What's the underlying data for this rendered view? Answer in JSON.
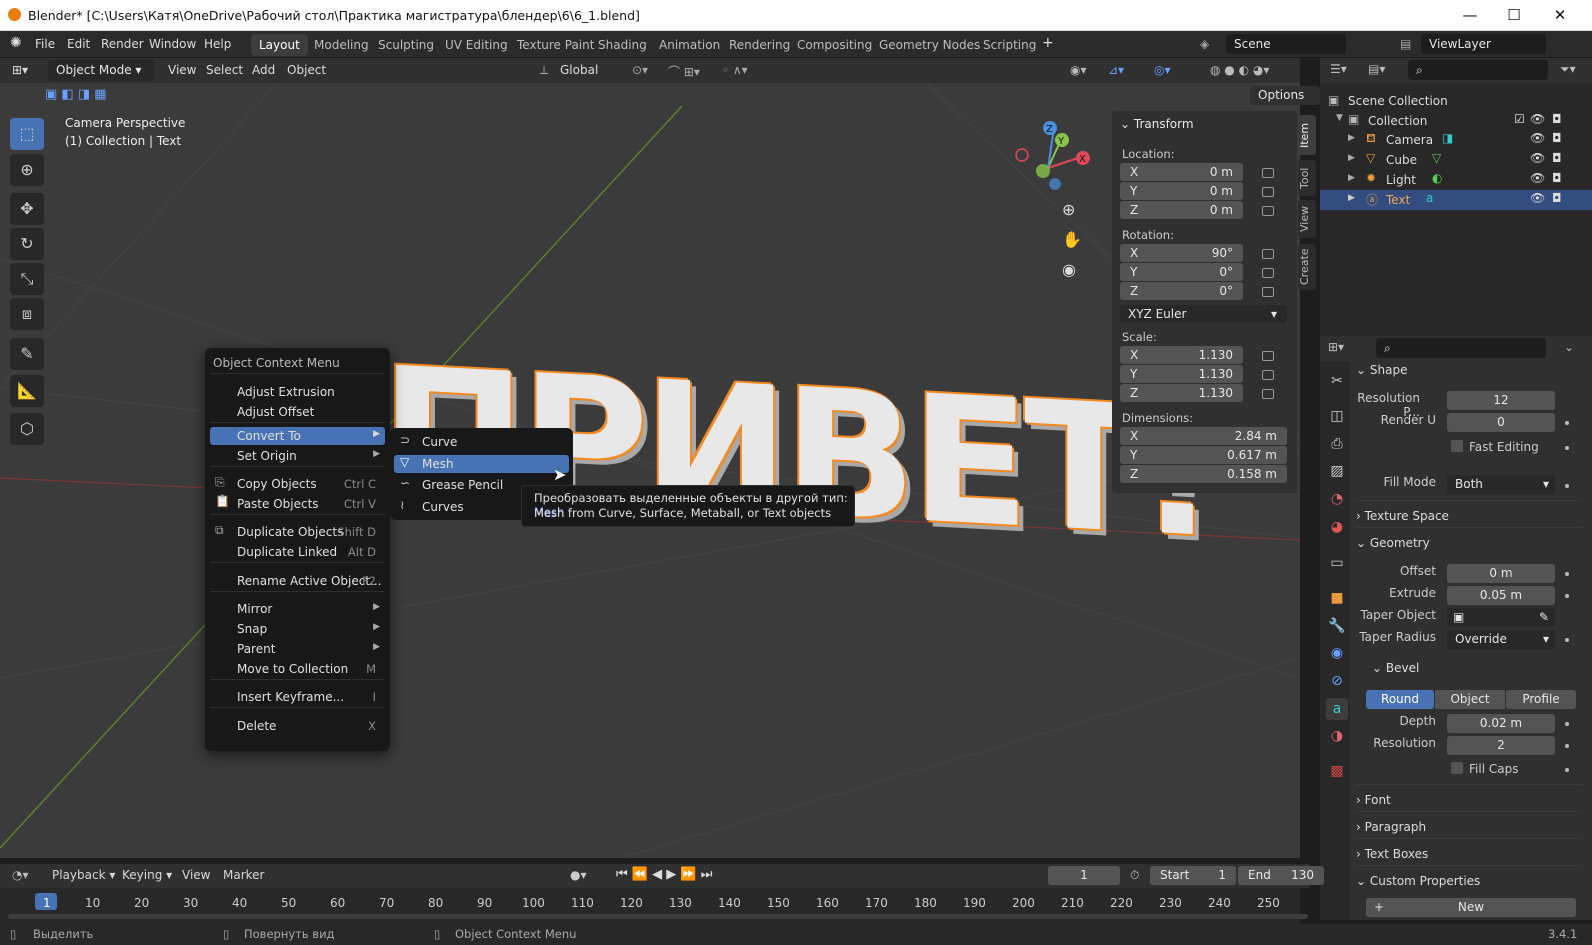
{
  "window": {
    "title": "Blender* [C:\\Users\\Катя\\OneDrive\\Рабочий стол\\Практика магистратура\\блендер\\6\\6_1.blend]"
  },
  "menu": [
    "File",
    "Edit",
    "Render",
    "Window",
    "Help"
  ],
  "workspaces": [
    "Layout",
    "Modeling",
    "Sculpting",
    "UV Editing",
    "Texture Paint",
    "Shading",
    "Animation",
    "Rendering",
    "Compositing",
    "Geometry Nodes",
    "Scripting"
  ],
  "scene": "Scene",
  "view_layer": "ViewLayer",
  "viewport": {
    "mode": "Object Mode",
    "menus": [
      "View",
      "Select",
      "Add",
      "Object"
    ],
    "orientation": "Global",
    "options": "Options",
    "camera_label": "Camera Perspective",
    "collection_label": "(1) Collection | Text",
    "text_object": "ПРИВЕТ!"
  },
  "transform": {
    "title": "Transform",
    "location_label": "Location:",
    "rotation_label": "Rotation:",
    "scale_label": "Scale:",
    "dimensions_label": "Dimensions:",
    "location": [
      {
        "a": "X",
        "v": "0 m"
      },
      {
        "a": "Y",
        "v": "0 m"
      },
      {
        "a": "Z",
        "v": "0 m"
      }
    ],
    "rotation": [
      {
        "a": "X",
        "v": "90°"
      },
      {
        "a": "Y",
        "v": "0°"
      },
      {
        "a": "Z",
        "v": "0°"
      }
    ],
    "rotation_mode": "XYZ Euler",
    "scale": [
      {
        "a": "X",
        "v": "1.130"
      },
      {
        "a": "Y",
        "v": "1.130"
      },
      {
        "a": "Z",
        "v": "1.130"
      }
    ],
    "dimensions": [
      {
        "a": "X",
        "v": "2.84 m"
      },
      {
        "a": "Y",
        "v": "0.617 m"
      },
      {
        "a": "Z",
        "v": "0.158 m"
      }
    ]
  },
  "side_tabs": [
    "Item",
    "Tool",
    "View",
    "Create"
  ],
  "context_menu": {
    "title": "Object Context Menu",
    "items": [
      {
        "label": "Adjust Extrusion",
        "shortcut": ""
      },
      {
        "label": "Adjust Offset",
        "shortcut": ""
      },
      {
        "label": "Convert To",
        "shortcut": ""
      },
      {
        "label": "Set Origin",
        "shortcut": ""
      },
      {
        "label": "Copy Objects",
        "shortcut": "Ctrl C"
      },
      {
        "label": "Paste Objects",
        "shortcut": "Ctrl V"
      },
      {
        "label": "Duplicate Objects",
        "shortcut": "Shift D"
      },
      {
        "label": "Duplicate Linked",
        "shortcut": "Alt D"
      },
      {
        "label": "Rename Active Object...",
        "shortcut": "F2"
      },
      {
        "label": "Mirror",
        "shortcut": ""
      },
      {
        "label": "Snap",
        "shortcut": ""
      },
      {
        "label": "Parent",
        "shortcut": ""
      },
      {
        "label": "Move to Collection",
        "shortcut": "M"
      },
      {
        "label": "Insert Keyframe...",
        "shortcut": "I"
      },
      {
        "label": "Delete",
        "shortcut": "X"
      }
    ]
  },
  "submenu": [
    "Curve",
    "Mesh",
    "Grease Pencil",
    "Curves"
  ],
  "tooltip": {
    "line1": "Преобразовать выделенные объекты в другой тип:",
    "type": "Mesh",
    "line2": "Mesh from Curve, Surface, Metaball, or Text objects"
  },
  "outliner": {
    "root": "Scene Collection",
    "collection": "Collection",
    "objects": [
      "Camera",
      "Cube",
      "Light",
      "Text"
    ]
  },
  "properties": {
    "shape": {
      "title": "Shape",
      "res_label": "Resolution P...",
      "res": "12",
      "render_label": "Render U",
      "render": "0",
      "fast": "Fast Editing",
      "fill_label": "Fill Mode",
      "fill": "Both"
    },
    "texture_space": "Texture Space",
    "geometry": {
      "title": "Geometry",
      "offset_label": "Offset",
      "offset": "0 m",
      "extrude_label": "Extrude",
      "extrude": "0.05 m",
      "taper_label": "Taper Object",
      "taper_radius_label": "Taper Radius",
      "taper_radius": "Override"
    },
    "bevel": {
      "title": "Bevel",
      "modes": [
        "Round",
        "Object",
        "Profile"
      ],
      "depth_label": "Depth",
      "depth": "0.02 m",
      "res_label": "Resolution",
      "res": "2",
      "fill_caps": "Fill Caps"
    },
    "collapsed": [
      "Font",
      "Paragraph",
      "Text Boxes"
    ],
    "custom": "Custom Properties",
    "new": "New"
  },
  "timeline": {
    "menus": [
      "Playback",
      "Keying",
      "View",
      "Marker"
    ],
    "current": "1",
    "start_label": "Start",
    "start": "1",
    "end_label": "End",
    "end": "130",
    "frames": [
      "1",
      "10",
      "20",
      "30",
      "40",
      "50",
      "60",
      "70",
      "80",
      "90",
      "100",
      "110",
      "120",
      "130",
      "140",
      "150",
      "160",
      "170",
      "180",
      "190",
      "200",
      "210",
      "220",
      "230",
      "240",
      "250"
    ]
  },
  "status": {
    "select": "Выделить",
    "rotate": "Повернуть вид",
    "context": "Object Context Menu",
    "version": "3.4.1"
  }
}
